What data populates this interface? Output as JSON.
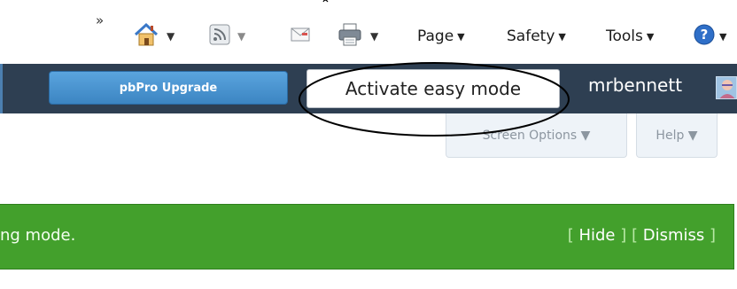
{
  "ie_toolbar": {
    "chevron": "»",
    "page_label": "Page",
    "safety_label": "Safety",
    "tools_label": "Tools",
    "dropdown_glyph": "▼"
  },
  "admin_bar": {
    "upgrade_label": "pbPro Upgrade",
    "easy_mode_label": "Activate easy mode",
    "username": "mrbennett"
  },
  "screen_meta": {
    "screen_options_label": "Screen Options ▼",
    "help_label": "Help ▼"
  },
  "notice": {
    "text": "ng mode.",
    "hide_link": "Hide",
    "dismiss_link": "Dismiss"
  },
  "colors": {
    "admin_bar_bg": "#2e3f52",
    "upgrade_button": "#4a96d3",
    "notice_bg": "#43a02c",
    "annotation_ellipse": "#000000"
  }
}
